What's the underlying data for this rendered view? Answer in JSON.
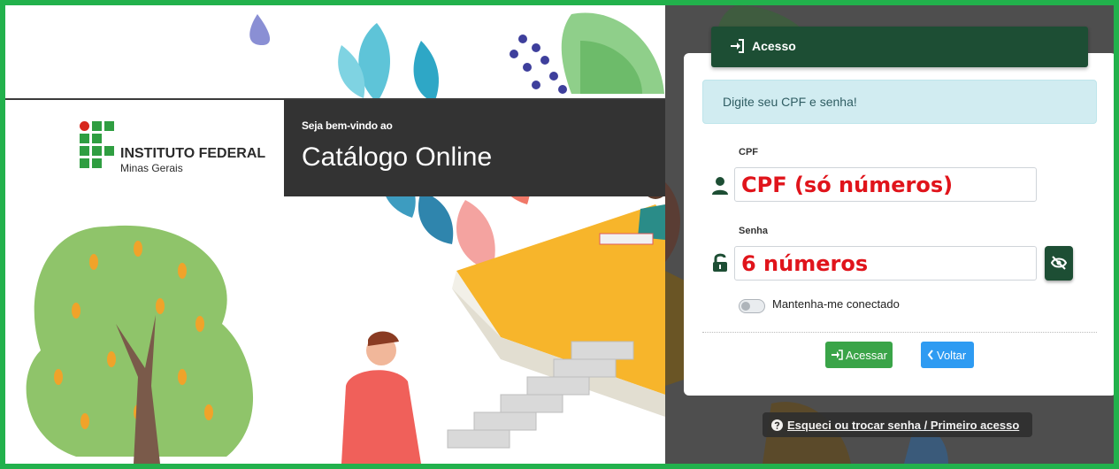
{
  "brand": {
    "line1": "INSTITUTO FEDERAL",
    "line2": "Minas Gerais"
  },
  "welcome": {
    "small": "Seja bem-vindo ao",
    "title": "Catálogo Online"
  },
  "card": {
    "header": "Acesso",
    "alert": "Digite seu CPF e senha!",
    "cpf_label": "CPF",
    "cpf_placeholder": "CPF (só números)",
    "senha_label": "Senha",
    "senha_placeholder": "6 números",
    "remember_label": "Mantenha-me conectado",
    "remember_checked": false,
    "acessar_label": "Acessar",
    "voltar_label": "Voltar"
  },
  "forgot_link": "Esqueci ou trocar senha / Primeiro acesso",
  "colors": {
    "outer_border": "#22b14c",
    "header_green": "#1d4e34",
    "acessar_green": "#3aa448",
    "voltar_blue": "#2e9bf2",
    "placeholder_red": "#e0141b",
    "alert_bg": "#d1ecf1"
  }
}
